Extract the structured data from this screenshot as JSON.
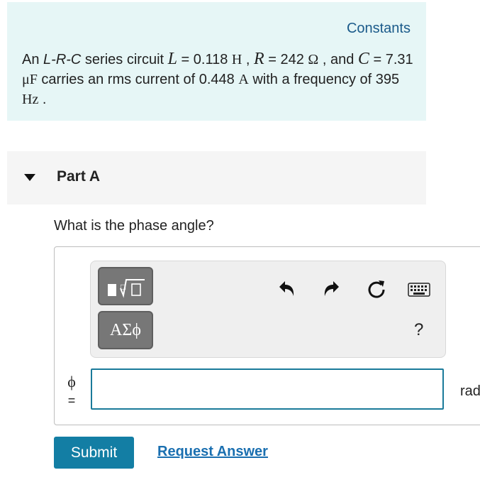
{
  "problem": {
    "constants_link": "Constants",
    "text": {
      "intro": "An ",
      "circuit_type": "L-R-C",
      "series_circuit": " series circuit ",
      "L_symbol": "L",
      "L_eq": " = 0.118 ",
      "L_unit": "H",
      "sep1": " , ",
      "R_symbol": "R",
      "R_eq": " = 242 ",
      "R_unit": "Ω",
      "sep2": " , and ",
      "C_symbol": "C",
      "C_eq": " = 7.31 ",
      "C_unit": "μF",
      "current_text": " carries an rms current of 0.448 ",
      "current_unit": "A",
      "freq_text": " with a frequency of 395 ",
      "freq_unit": "Hz",
      "end": " ."
    }
  },
  "part": {
    "title": "Part A",
    "question": "What is the phase angle?"
  },
  "toolbar": {
    "greek_label": "ΑΣϕ",
    "help": "?",
    "icons": [
      "templates-icon",
      "undo-icon",
      "redo-icon",
      "reset-icon",
      "keyboard-icon"
    ]
  },
  "answer": {
    "variable": "ϕ",
    "equals": "=",
    "value": "",
    "unit": "rad"
  },
  "actions": {
    "submit": "Submit",
    "request_answer": "Request Answer"
  },
  "colors": {
    "problem_bg": "#e6f6f6",
    "accent": "#137ea4",
    "link": "#1a6fb0"
  }
}
